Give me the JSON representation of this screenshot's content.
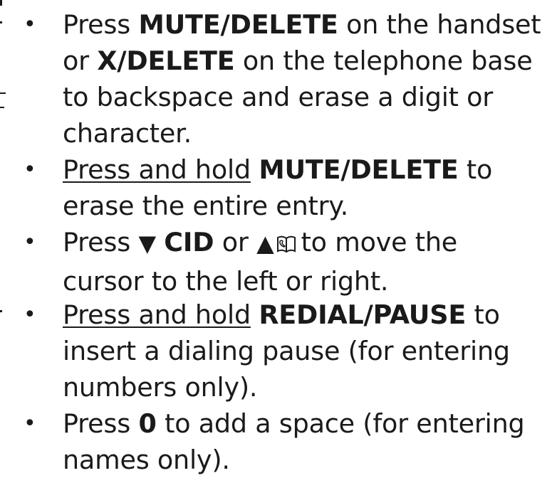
{
  "bullet_glyph": "•",
  "items": [
    {
      "w1": "Press",
      "k1": "MUTE/DELETE",
      "t1": "on the handset",
      "w2": "or",
      "k2": "X/DELETE",
      "t2": "on the telephone base",
      "l3": "to backspace and erase a digit or",
      "l4": "character."
    },
    {
      "u": "Press and hold",
      "k": "MUTE/DELETE",
      "t": "to",
      "l2": "erase the entire entry."
    },
    {
      "w1": "Press",
      "down_arrow": "▼",
      "k": "CID",
      "or": "or",
      "up_arrow": "▲",
      "book_icon": "phonebook-icon",
      "t": "to move the",
      "l2": "cursor to the left or right."
    },
    {
      "u": "Press and hold",
      "k": "REDIAL/PAUSE",
      "t": "to",
      "l2": "insert a dialing pause (for entering",
      "l3": "numbers only)."
    },
    {
      "w1": "Press",
      "k": "0",
      "t": "to add a space (for entering",
      "l2": "names only)."
    }
  ]
}
